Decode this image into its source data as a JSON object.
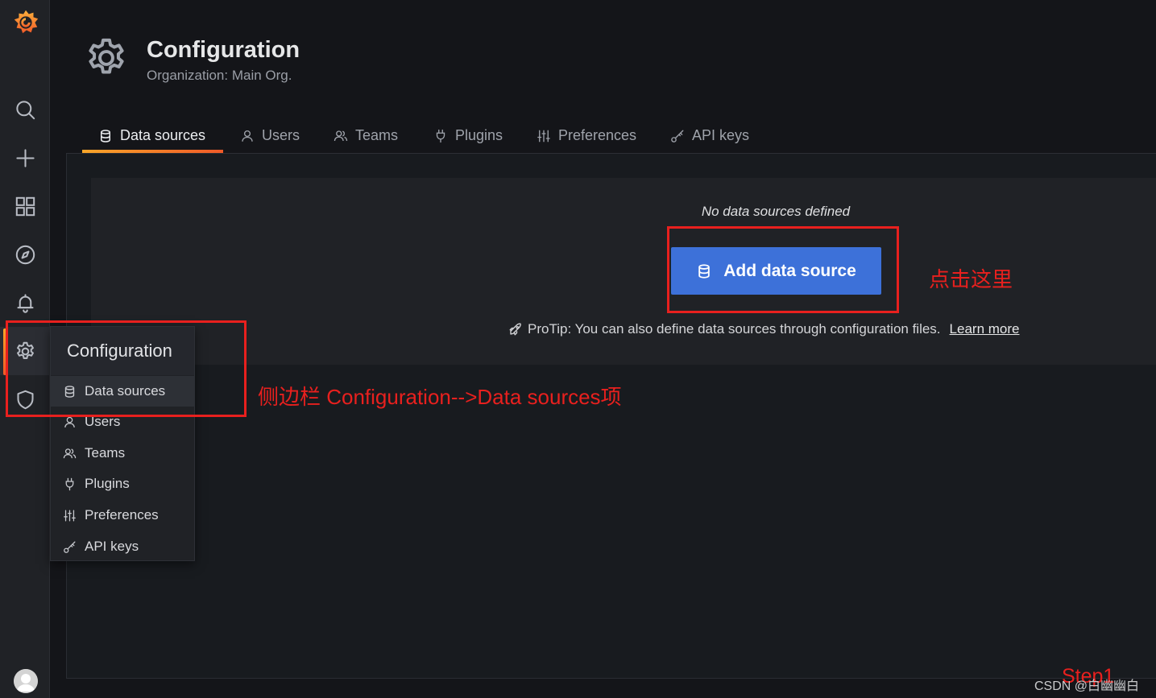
{
  "sidebar": {
    "items": [
      {
        "name": "search",
        "icon": "search-icon"
      },
      {
        "name": "create",
        "icon": "plus-icon"
      },
      {
        "name": "dashboards",
        "icon": "apps-icon"
      },
      {
        "name": "explore",
        "icon": "compass-icon"
      },
      {
        "name": "alerting",
        "icon": "bell-icon"
      },
      {
        "name": "configuration",
        "icon": "gear-icon",
        "active": true
      },
      {
        "name": "server-admin",
        "icon": "shield-icon"
      }
    ]
  },
  "header": {
    "title": "Configuration",
    "subtitle": "Organization: Main Org."
  },
  "tabs": [
    {
      "label": "Data sources",
      "icon": "database-icon",
      "active": true
    },
    {
      "label": "Users",
      "icon": "user-icon"
    },
    {
      "label": "Teams",
      "icon": "users-icon"
    },
    {
      "label": "Plugins",
      "icon": "plug-icon"
    },
    {
      "label": "Preferences",
      "icon": "sliders-icon"
    },
    {
      "label": "API keys",
      "icon": "key-icon"
    }
  ],
  "empty_state": {
    "title": "No data sources defined",
    "button_label": "Add data source",
    "protip": "ProTip: You can also define data sources through configuration files.",
    "learn_more": "Learn more"
  },
  "hover_menu": {
    "title": "Configuration",
    "items": [
      {
        "label": "Data sources",
        "icon": "database-icon",
        "active": true
      },
      {
        "label": "Users",
        "icon": "user-icon"
      },
      {
        "label": "Teams",
        "icon": "users-icon"
      },
      {
        "label": "Plugins",
        "icon": "plug-icon"
      },
      {
        "label": "Preferences",
        "icon": "sliders-icon"
      },
      {
        "label": "API keys",
        "icon": "key-icon"
      }
    ]
  },
  "annotations": {
    "click_here": "点击这里",
    "sidebar_note": "侧边栏 Configuration-->Data sources项",
    "step": "Step1",
    "color": "#e8201e"
  },
  "watermark": "CSDN @白幽幽白",
  "colors": {
    "accent_orange": "#f05a28",
    "primary_button": "#3d71d9",
    "background": "#141519"
  }
}
